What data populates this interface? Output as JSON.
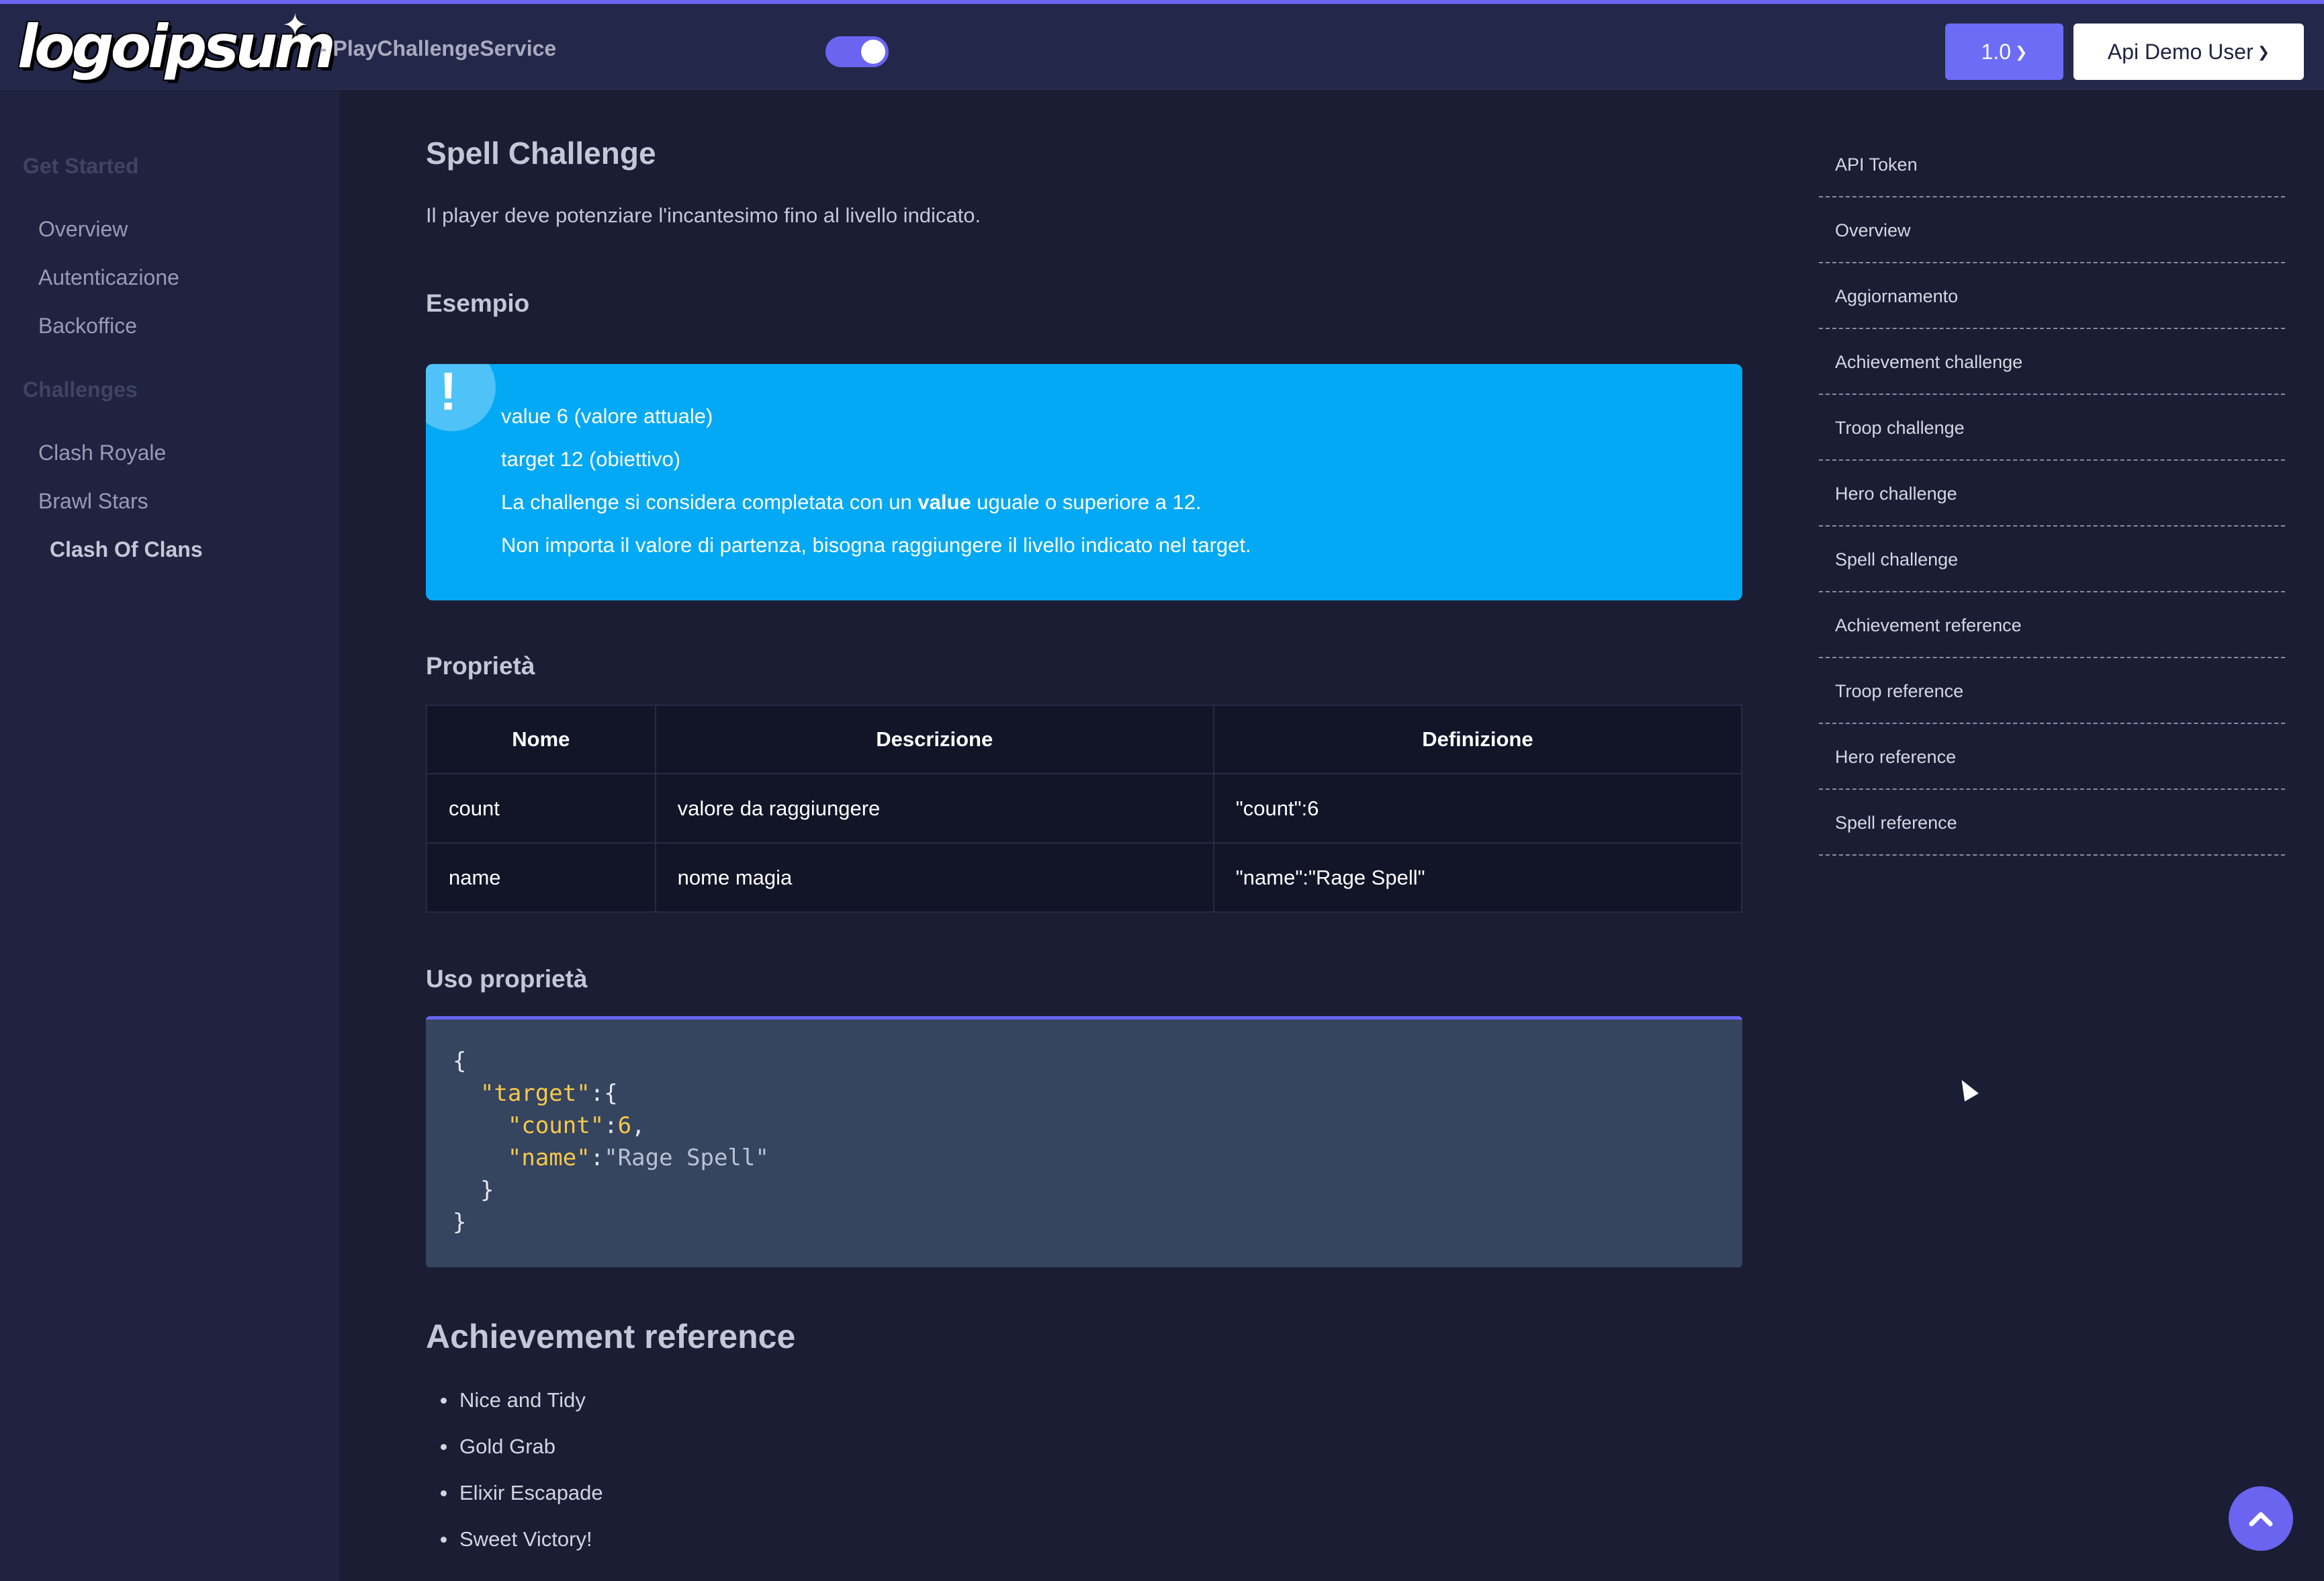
{
  "header": {
    "logo_text": "logoipsum",
    "service_name": "- PlayChallengeService",
    "version_label": "1.0",
    "user_label": "Api Demo User",
    "theme_toggle_on": true
  },
  "sidebar": {
    "sections": [
      {
        "heading": "Get Started",
        "items": [
          {
            "label": "Overview"
          },
          {
            "label": "Autenticazione"
          },
          {
            "label": "Backoffice"
          }
        ]
      },
      {
        "heading": "Challenges",
        "items": [
          {
            "label": "Clash Royale"
          },
          {
            "label": "Brawl Stars"
          },
          {
            "label": "Clash Of Clans",
            "active": true
          }
        ]
      }
    ]
  },
  "main": {
    "title": "Spell Challenge",
    "description": "Il player deve potenziare l'incantesimo fino al livello indicato.",
    "example_heading": "Esempio",
    "callout": {
      "icon": "exclamation-icon",
      "lines": [
        "value 6 (valore attuale)",
        "target 12 (obiettivo)"
      ],
      "line3_before": "La challenge si considera completata con un ",
      "line3_bold": "value",
      "line3_after": " uguale o superiore a 12.",
      "line4": "Non importa il valore di partenza, bisogna raggiungere il livello indicato nel target."
    },
    "props_heading": "Proprietà",
    "props_table": {
      "headers": [
        "Nome",
        "Descrizione",
        "Definizione"
      ],
      "rows": [
        [
          "count",
          "valore da raggiungere",
          "\"count\":6"
        ],
        [
          "name",
          "nome magia",
          "\"name\":\"Rage Spell\""
        ]
      ]
    },
    "usage_heading": "Uso proprietà",
    "code": {
      "open": "{",
      "target_key": "\"target\"",
      "count_key": "\"count\"",
      "count_value": "6",
      "name_key": "\"name\"",
      "name_value": "\"Rage Spell\"",
      "inner_close": "}",
      "close": "}"
    },
    "achievement_heading": "Achievement reference",
    "achievements": [
      "Nice and Tidy",
      "Gold Grab",
      "Elixir Escapade",
      "Sweet Victory!"
    ]
  },
  "toc": {
    "items": [
      "API Token",
      "Overview",
      "Aggiornamento",
      "Achievement challenge",
      "Troop challenge",
      "Hero challenge",
      "Spell challenge",
      "Achievement reference",
      "Troop reference",
      "Hero reference",
      "Spell reference"
    ]
  },
  "colors": {
    "accent": "#6a64f1",
    "callout": "#03a9f4",
    "background": "#1a1d33",
    "sidebar": "#1f2340"
  },
  "icons": {
    "scroll_top": "chevron-up-icon",
    "dropdown": "chevron-down-icon"
  }
}
